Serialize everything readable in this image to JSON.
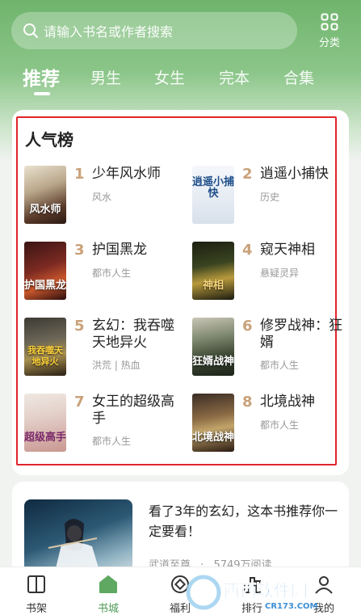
{
  "search": {
    "placeholder": "请输入书名或作者搜索"
  },
  "category_label": "分类",
  "tabs": [
    "推荐",
    "男生",
    "女生",
    "完本",
    "合集"
  ],
  "ranking": {
    "title": "人气榜",
    "books": [
      {
        "rank": "1",
        "title": "少年风水师",
        "category": "风水",
        "cover_text": "风水师"
      },
      {
        "rank": "2",
        "title": "逍遥小捕快",
        "category": "历史",
        "cover_text": "逍遥小捕快"
      },
      {
        "rank": "3",
        "title": "护国黑龙",
        "category": "都市人生",
        "cover_text": "护国黑龙"
      },
      {
        "rank": "4",
        "title": "窥天神相",
        "category": "悬疑灵异",
        "cover_text": "神相"
      },
      {
        "rank": "5",
        "title": "玄幻：我吞噬天地异火",
        "category": "洪荒 | 热血",
        "cover_text": "我吞噬天地异火"
      },
      {
        "rank": "6",
        "title": "修罗战神：狂婿",
        "category": "都市人生",
        "cover_text": "狂婿战神"
      },
      {
        "rank": "7",
        "title": "女王的超级高手",
        "category": "都市人生",
        "cover_text": "超级高手"
      },
      {
        "rank": "8",
        "title": "北境战神",
        "category": "都市人生",
        "cover_text": "北境战神"
      }
    ]
  },
  "promo": {
    "text": "看了3年的玄幻，这本书推荐你一定要看！",
    "author": "武道至尊",
    "reads": "5749万阅读",
    "separator": "·"
  },
  "bottom_nav": [
    {
      "label": "书架",
      "icon": "bookshelf-icon"
    },
    {
      "label": "书城",
      "icon": "bookstore-icon"
    },
    {
      "label": "福利",
      "icon": "welfare-icon"
    },
    {
      "label": "排行",
      "icon": "ranking-icon"
    },
    {
      "label": "我的",
      "icon": "profile-icon"
    }
  ],
  "watermark": {
    "brand": "西西软件园",
    "url": "CR173.COM"
  },
  "colors": {
    "accent": "#4e9a55",
    "rank": "#c9a27a",
    "highlight_border": "#e0242a"
  }
}
